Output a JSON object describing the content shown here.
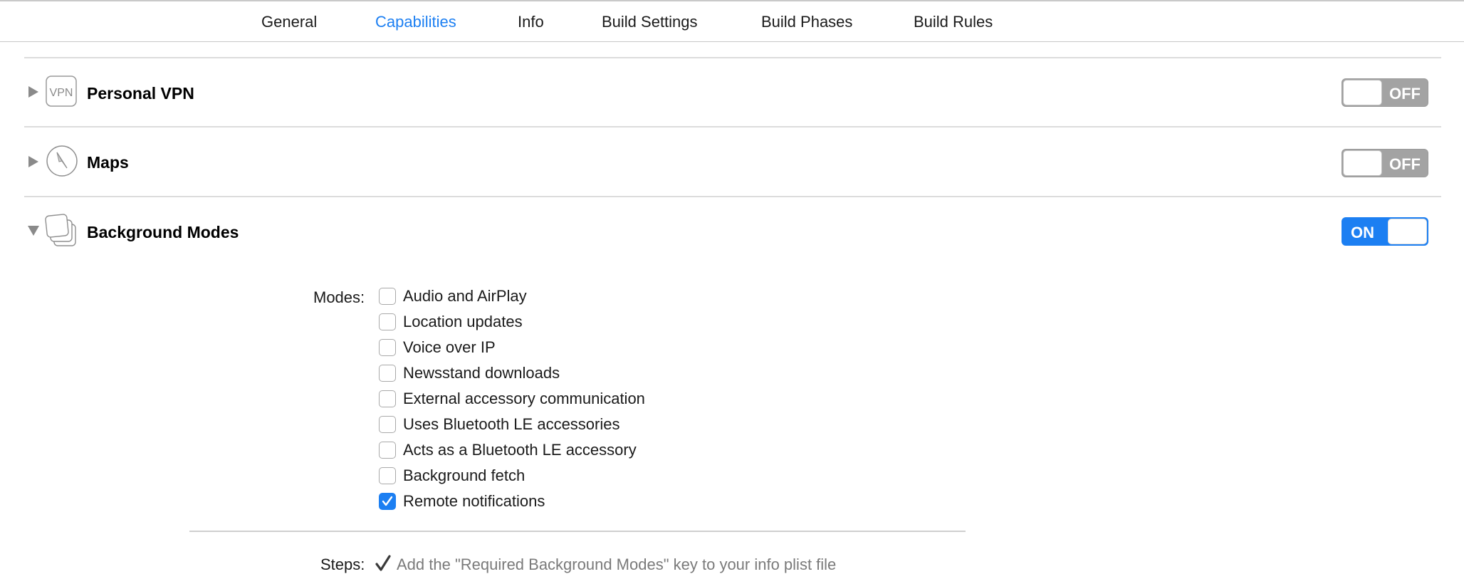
{
  "tabs": [
    {
      "label": "General",
      "active": false
    },
    {
      "label": "Capabilities",
      "active": true
    },
    {
      "label": "Info",
      "active": false
    },
    {
      "label": "Build Settings",
      "active": false
    },
    {
      "label": "Build Phases",
      "active": false
    },
    {
      "label": "Build Rules",
      "active": false
    }
  ],
  "capabilities": [
    {
      "title": "Personal VPN",
      "icon": "vpn-icon",
      "icon_text": "VPN",
      "expanded": false,
      "toggle": "OFF"
    },
    {
      "title": "Maps",
      "icon": "compass-icon",
      "expanded": false,
      "toggle": "OFF"
    },
    {
      "title": "Background Modes",
      "icon": "stacked-windows-icon",
      "expanded": true,
      "toggle": "ON"
    }
  ],
  "modes_label": "Modes:",
  "modes": [
    {
      "label": "Audio and AirPlay",
      "checked": false
    },
    {
      "label": "Location updates",
      "checked": false
    },
    {
      "label": "Voice over IP",
      "checked": false
    },
    {
      "label": "Newsstand downloads",
      "checked": false
    },
    {
      "label": "External accessory communication",
      "checked": false
    },
    {
      "label": "Uses Bluetooth LE accessories",
      "checked": false
    },
    {
      "label": "Acts as a Bluetooth LE accessory",
      "checked": false
    },
    {
      "label": "Background fetch",
      "checked": false
    },
    {
      "label": "Remote notifications",
      "checked": true
    }
  ],
  "steps_label": "Steps:",
  "steps": [
    {
      "text": "Add the \"Required Background Modes\" key to your info plist file",
      "done": true
    }
  ],
  "colors": {
    "accent": "#1c7ff2",
    "toggle_off": "#a3a3a3",
    "divider": "#dcdcdc",
    "step_text": "#7a7a7a"
  }
}
